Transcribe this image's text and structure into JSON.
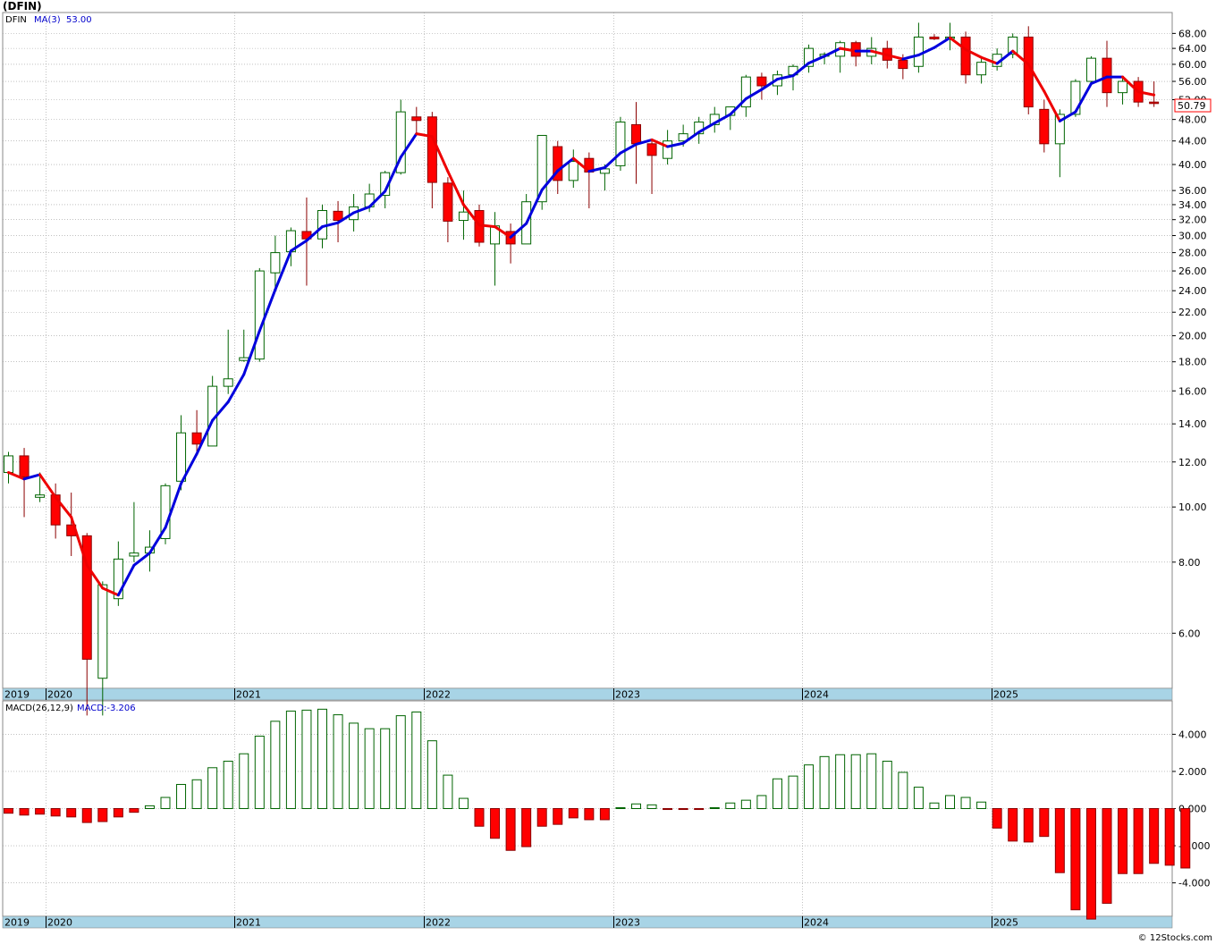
{
  "chart_data": [
    {
      "type": "candlestick",
      "title": "(DFIN)",
      "scale": "log",
      "ylim": [
        4.8,
        74
      ],
      "y_ticks": [
        "6.00",
        "8.00",
        "10.00",
        "12.00",
        "14.00",
        "16.00",
        "18.00",
        "20.00",
        "22.00",
        "24.00",
        "26.00",
        "28.00",
        "30.00",
        "32.00",
        "34.00",
        "36.00",
        "40.00",
        "44.00",
        "48.00",
        "52.00",
        "56.00",
        "60.00",
        "64.00",
        "68.00"
      ],
      "x_labels": [
        "2019",
        "2020",
        "2021",
        "2022",
        "2023",
        "2024",
        "2025"
      ],
      "last_price": "50.79",
      "legend": {
        "ticker": "DFIN",
        "ma_label": "MA(3)",
        "ma_value": "53.00"
      },
      "colors": {
        "up": "#006400",
        "down": "#ff0000",
        "ma_up": "#0000dd",
        "ma_down": "#ee0000",
        "band": "#a8d4e6"
      },
      "grid": true,
      "series": [
        {
          "name": "DFIN",
          "ohlc": [
            [
              11.5,
              12.5,
              11.0,
              12.3
            ],
            [
              12.3,
              12.7,
              9.6,
              11.3
            ],
            [
              10.4,
              11.5,
              10.2,
              10.5
            ],
            [
              10.5,
              11.0,
              8.8,
              9.3
            ],
            [
              9.3,
              10.6,
              8.2,
              8.9
            ],
            [
              8.9,
              9.0,
              4.3,
              5.4
            ],
            [
              5.0,
              7.4,
              4.3,
              7.3
            ],
            [
              6.9,
              8.7,
              6.7,
              8.1
            ],
            [
              8.2,
              10.2,
              8.0,
              8.3
            ],
            [
              8.3,
              9.1,
              7.7,
              8.5
            ],
            [
              8.8,
              11.0,
              8.6,
              10.9
            ],
            [
              11.1,
              14.5,
              10.7,
              13.5
            ],
            [
              13.5,
              14.8,
              12.3,
              12.9
            ],
            [
              12.8,
              17.0,
              12.8,
              16.3
            ],
            [
              16.3,
              20.5,
              15.8,
              16.8
            ],
            [
              18.1,
              20.5,
              18.0,
              18.3
            ],
            [
              18.2,
              26.3,
              18.0,
              26.0
            ],
            [
              25.8,
              30.0,
              24.0,
              28.0
            ],
            [
              28.1,
              31.0,
              26.5,
              30.6
            ],
            [
              30.5,
              35.0,
              24.5,
              29.6
            ],
            [
              29.6,
              34.0,
              28.5,
              33.2
            ],
            [
              33.1,
              34.5,
              29.2,
              31.9
            ],
            [
              32.0,
              35.5,
              30.5,
              33.7
            ],
            [
              33.7,
              37.0,
              33.0,
              35.5
            ],
            [
              35.3,
              39.0,
              33.5,
              38.7
            ],
            [
              38.7,
              52.0,
              38.4,
              49.5
            ],
            [
              48.5,
              50.5,
              45.5,
              47.8
            ],
            [
              48.5,
              49.5,
              33.5,
              37.2
            ],
            [
              37.1,
              38.0,
              29.2,
              31.8
            ],
            [
              31.9,
              36.0,
              29.5,
              33.0
            ],
            [
              33.2,
              34.0,
              28.7,
              29.2
            ],
            [
              29.0,
              33.0,
              24.5,
              31.2
            ],
            [
              30.5,
              31.5,
              26.8,
              29.0
            ],
            [
              29.0,
              35.5,
              29.0,
              34.4
            ],
            [
              34.4,
              45.0,
              33.3,
              45.0
            ],
            [
              43.0,
              44.0,
              35.5,
              37.5
            ],
            [
              37.5,
              42.5,
              36.4,
              40.5
            ],
            [
              41.0,
              42.0,
              33.5,
              38.8
            ],
            [
              38.6,
              40.0,
              36.0,
              39.3
            ],
            [
              39.8,
              48.5,
              39.0,
              47.5
            ],
            [
              47.0,
              51.5,
              37.0,
              43.5
            ],
            [
              43.5,
              44.0,
              35.5,
              41.5
            ],
            [
              41.0,
              46.0,
              40.0,
              44.0
            ],
            [
              44.0,
              47.0,
              43.0,
              45.3
            ],
            [
              45.3,
              48.5,
              43.5,
              47.5
            ],
            [
              47.0,
              50.5,
              45.5,
              49.0
            ],
            [
              48.8,
              50.0,
              46.0,
              50.5
            ],
            [
              50.5,
              57.5,
              48.5,
              57.0
            ],
            [
              57.0,
              58.0,
              52.0,
              55.0
            ],
            [
              55.0,
              58.5,
              53.0,
              57.5
            ],
            [
              57.5,
              60.0,
              54.0,
              59.5
            ],
            [
              59.5,
              65.0,
              58.0,
              64.0
            ],
            [
              62.0,
              63.0,
              60.0,
              62.5
            ],
            [
              62.0,
              66.0,
              58.0,
              65.5
            ],
            [
              65.5,
              66.0,
              59.5,
              62.0
            ],
            [
              62.0,
              67.0,
              60.0,
              64.0
            ],
            [
              64.0,
              66.0,
              59.0,
              61.0
            ],
            [
              61.0,
              62.5,
              56.5,
              59.0
            ],
            [
              59.5,
              71.0,
              58.0,
              67.0
            ],
            [
              67.0,
              67.8,
              66.2,
              66.5
            ],
            [
              67.0,
              71.0,
              63.5,
              67.0
            ],
            [
              67.0,
              68.5,
              55.5,
              57.5
            ],
            [
              57.5,
              61.5,
              55.5,
              60.5
            ],
            [
              59.5,
              64.0,
              58.5,
              62.5
            ],
            [
              62.5,
              68.0,
              61.5,
              67.0
            ],
            [
              67.0,
              70.0,
              49.0,
              50.5
            ],
            [
              50.0,
              52.0,
              42.0,
              43.5
            ],
            [
              43.5,
              50.0,
              38.0,
              49.0
            ],
            [
              49.0,
              56.5,
              48.5,
              56.0
            ],
            [
              56.0,
              62.0,
              55.0,
              61.5
            ],
            [
              61.5,
              66.0,
              50.5,
              53.5
            ],
            [
              53.5,
              57.0,
              51.0,
              56.0
            ],
            [
              56.0,
              57.0,
              50.5,
              51.5
            ],
            [
              51.5,
              56.0,
              50.5,
              51.2
            ]
          ]
        },
        {
          "name": "MA(3)",
          "values": [
            11.5,
            11.2,
            11.4,
            10.4,
            9.6,
            7.9,
            7.2,
            7.0,
            7.9,
            8.3,
            9.2,
            11.0,
            12.4,
            14.2,
            15.3,
            17.1,
            20.4,
            24.1,
            28.2,
            29.4,
            31.1,
            31.6,
            32.9,
            33.7,
            35.9,
            41.2,
            45.3,
            44.8,
            38.9,
            34.0,
            31.3,
            31.1,
            29.8,
            31.5,
            36.1,
            39.0,
            41.0,
            38.9,
            39.5,
            41.9,
            43.4,
            44.2,
            43.0,
            43.6,
            45.6,
            47.3,
            49.0,
            52.2,
            54.2,
            56.5,
            57.3,
            60.3,
            62.0,
            64.0,
            63.3,
            63.3,
            62.3,
            61.3,
            62.3,
            64.2,
            66.8,
            63.7,
            61.7,
            60.2,
            63.3,
            60.0,
            53.8,
            47.7,
            49.5,
            55.5,
            57.0,
            57.0,
            53.7,
            53.0
          ]
        }
      ]
    },
    {
      "type": "bar",
      "title": "MACD(26,12,9)",
      "legend_value": "MACD:-3.206",
      "ylim": [
        -5.8,
        5.8
      ],
      "y_ticks": [
        "4.000",
        "2.000",
        "0.000",
        "-2.000",
        "-4.000"
      ],
      "x_labels": [
        "2019",
        "2020",
        "2021",
        "2022",
        "2023",
        "2024",
        "2025"
      ],
      "series": [
        {
          "name": "MACD",
          "values": [
            -0.25,
            -0.35,
            -0.3,
            -0.4,
            -0.45,
            -0.75,
            -0.7,
            -0.45,
            -0.2,
            0.15,
            0.6,
            1.3,
            1.55,
            2.2,
            2.55,
            2.95,
            3.9,
            4.7,
            5.25,
            5.3,
            5.35,
            5.05,
            4.6,
            4.3,
            4.3,
            5.0,
            5.2,
            3.65,
            1.8,
            0.55,
            -0.95,
            -1.6,
            -2.25,
            -2.05,
            -0.95,
            -0.85,
            -0.5,
            -0.6,
            -0.6,
            0.05,
            0.25,
            0.2,
            -0.05,
            -0.05,
            -0.05,
            0.05,
            0.3,
            0.45,
            0.7,
            1.6,
            1.75,
            2.35,
            2.8,
            2.9,
            2.9,
            2.95,
            2.55,
            1.95,
            1.15,
            0.3,
            0.7,
            0.6,
            0.35,
            -1.05,
            -1.75,
            -1.8,
            -1.5,
            -3.45,
            -5.45,
            -5.95,
            -5.1,
            -3.5,
            -3.5,
            -2.95,
            -3.05,
            -3.2
          ]
        }
      ]
    }
  ],
  "footer": {
    "credit": "© 12Stocks.com"
  }
}
